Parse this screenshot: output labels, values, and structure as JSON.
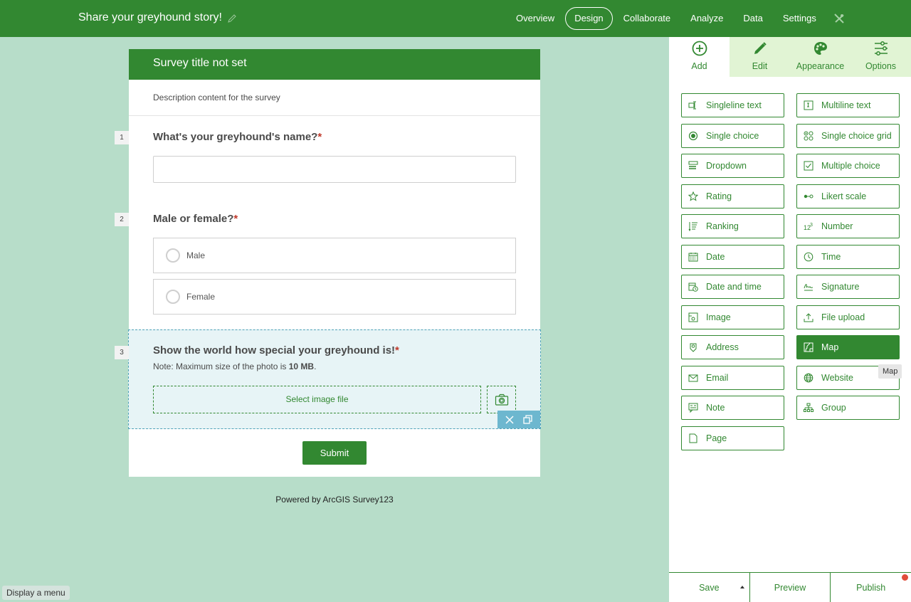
{
  "header": {
    "title": "Share your greyhound story!",
    "nav": [
      {
        "label": "Overview",
        "active": false
      },
      {
        "label": "Design",
        "active": true
      },
      {
        "label": "Collaborate",
        "active": false
      },
      {
        "label": "Analyze",
        "active": false
      },
      {
        "label": "Data",
        "active": false
      },
      {
        "label": "Settings",
        "active": false
      }
    ],
    "nav_extra_icon": "tools-icon"
  },
  "survey": {
    "title": "Survey title not set",
    "description": "Description content for the survey",
    "questions": [
      {
        "number": "1",
        "label": "What's your greyhound's name?",
        "required": "*",
        "type": "singleline",
        "value": ""
      },
      {
        "number": "2",
        "label": "Male or female?",
        "required": "*",
        "type": "single-choice",
        "options": [
          "Male",
          "Female"
        ]
      },
      {
        "number": "3",
        "label": "Show the world how special your greyhound is!",
        "required": "*",
        "type": "image",
        "note_prefix": "Note: Maximum size of the photo is ",
        "note_bold": "10 MB",
        "note_suffix": ".",
        "file_button": "Select image file"
      }
    ],
    "submit_label": "Submit",
    "powered_by": "Powered by ArcGIS Survey123"
  },
  "hint": "Display a menu",
  "panel": {
    "tabs": [
      {
        "label": "Add",
        "icon": "plus-circle-icon",
        "active": true
      },
      {
        "label": "Edit",
        "icon": "pencil-icon",
        "active": false
      },
      {
        "label": "Appearance",
        "icon": "palette-icon",
        "active": false
      },
      {
        "label": "Options",
        "icon": "sliders-icon",
        "active": false
      }
    ],
    "question_types": [
      {
        "label": "Singleline text",
        "icon": "singleline-text-icon"
      },
      {
        "label": "Multiline text",
        "icon": "multiline-text-icon"
      },
      {
        "label": "Single choice",
        "icon": "radio-icon"
      },
      {
        "label": "Single choice grid",
        "icon": "choice-grid-icon"
      },
      {
        "label": "Dropdown",
        "icon": "dropdown-icon"
      },
      {
        "label": "Multiple choice",
        "icon": "checkbox-icon"
      },
      {
        "label": "Rating",
        "icon": "star-icon"
      },
      {
        "label": "Likert scale",
        "icon": "likert-icon"
      },
      {
        "label": "Ranking",
        "icon": "ranking-icon"
      },
      {
        "label": "Number",
        "icon": "number-icon"
      },
      {
        "label": "Date",
        "icon": "calendar-icon"
      },
      {
        "label": "Time",
        "icon": "clock-icon"
      },
      {
        "label": "Date and time",
        "icon": "calendar-clock-icon"
      },
      {
        "label": "Signature",
        "icon": "signature-icon"
      },
      {
        "label": "Image",
        "icon": "image-icon"
      },
      {
        "label": "File upload",
        "icon": "upload-icon"
      },
      {
        "label": "Address",
        "icon": "location-pin-icon"
      },
      {
        "label": "Map",
        "icon": "map-icon",
        "hovered": true
      },
      {
        "label": "Email",
        "icon": "envelope-icon"
      },
      {
        "label": "Website",
        "icon": "globe-icon"
      },
      {
        "label": "Note",
        "icon": "note-icon"
      },
      {
        "label": "Group",
        "icon": "group-icon"
      },
      {
        "label": "Page",
        "icon": "page-icon"
      }
    ],
    "tooltip": "Map",
    "footer": {
      "save": "Save",
      "preview": "Preview",
      "publish": "Publish"
    }
  },
  "colors": {
    "brand": "#328831",
    "canvas_bg": "#b7ddc9",
    "tab_bg": "#e1f4d4",
    "selection": "#6db7cf",
    "required": "#c0392b",
    "notification": "#e14c3a"
  }
}
